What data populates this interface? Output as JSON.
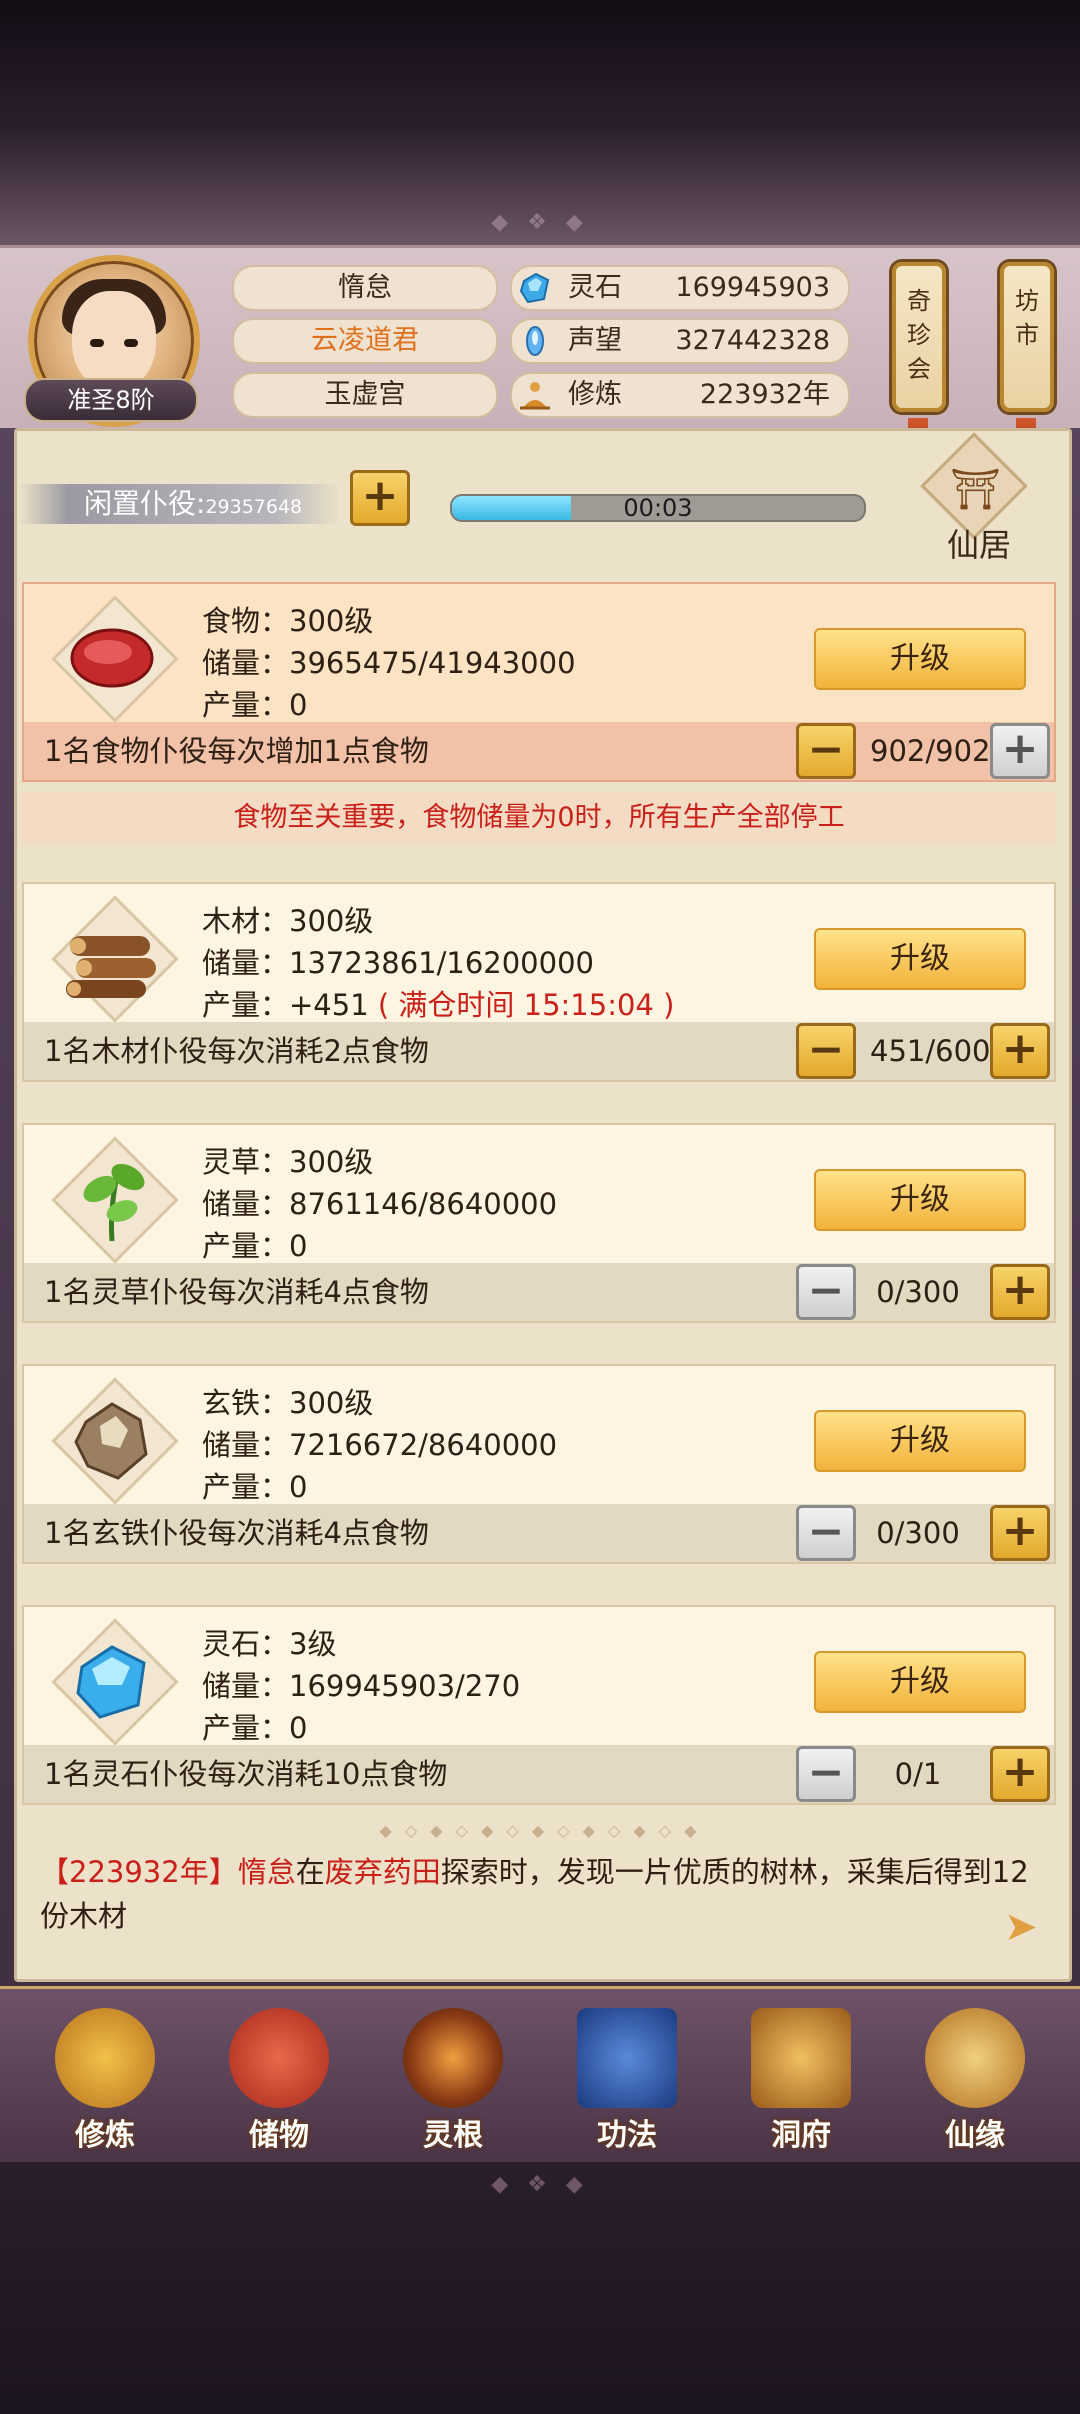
{
  "header": {
    "rank": "准圣8阶",
    "names": [
      "惰怠",
      "云凌道君",
      "玉虚宫"
    ],
    "stats": [
      {
        "label": "灵石",
        "value": "169945903",
        "icon": "spirit-stone-icon"
      },
      {
        "label": "声望",
        "value": "327442328",
        "icon": "reputation-icon"
      },
      {
        "label": "修炼",
        "value": "223932年",
        "icon": "cultivation-icon"
      }
    ],
    "scrolls": [
      "奇珍会",
      "坊市"
    ]
  },
  "idle": {
    "label": "闲置仆役:",
    "count": "29357648",
    "timer": "00:03",
    "progress": 0.29
  },
  "xianju": {
    "label": "仙居"
  },
  "resources": [
    {
      "name_level": "食物：300级",
      "storage": "储量：3965475/41943000",
      "output": "产量：0",
      "output_extra": "",
      "upgrade": "升级",
      "desc": "1名食物仆役每次增加1点食物",
      "count": "902/902",
      "icon": "meat-icon"
    },
    {
      "name_level": "木材：300级",
      "storage": "储量：13723861/16200000",
      "output": "产量：+451",
      "output_extra": "( 满仓时间 15:15:04 )",
      "upgrade": "升级",
      "desc": "1名木材仆役每次消耗2点食物",
      "count": "451/600",
      "icon": "wood-logs-icon"
    },
    {
      "name_level": "灵草：300级",
      "storage": "储量：8761146/8640000",
      "output": "产量：0",
      "output_extra": "",
      "upgrade": "升级",
      "desc": "1名灵草仆役每次消耗4点食物",
      "count": "0/300",
      "icon": "herb-icon"
    },
    {
      "name_level": "玄铁：300级",
      "storage": "储量：7216672/8640000",
      "output": "产量：0",
      "output_extra": "",
      "upgrade": "升级",
      "desc": "1名玄铁仆役每次消耗4点食物",
      "count": "0/300",
      "icon": "iron-ore-icon"
    },
    {
      "name_level": "灵石：3级",
      "storage": "储量：169945903/270",
      "output": "产量：0",
      "output_extra": "",
      "upgrade": "升级",
      "desc": "1名灵石仆役每次消耗10点食物",
      "count": "0/1",
      "icon": "crystal-icon"
    }
  ],
  "warning": "食物至关重要，食物储量为0时，所有生产全部停工",
  "log": {
    "year": "【223932年】",
    "name": "惰怠",
    "text1": "在",
    "place": "废弃药田",
    "text2": "探索时，发现一片优质的树林，采集后得到12份木材"
  },
  "nav": [
    "修炼",
    "储物",
    "灵根",
    "功法",
    "洞府",
    "仙缘"
  ],
  "colors": {
    "accent_red": "#c9201a",
    "accent_orange": "#e0711c",
    "button_gold": "#f2b33a",
    "progress_blue": "#3ab8e4"
  }
}
